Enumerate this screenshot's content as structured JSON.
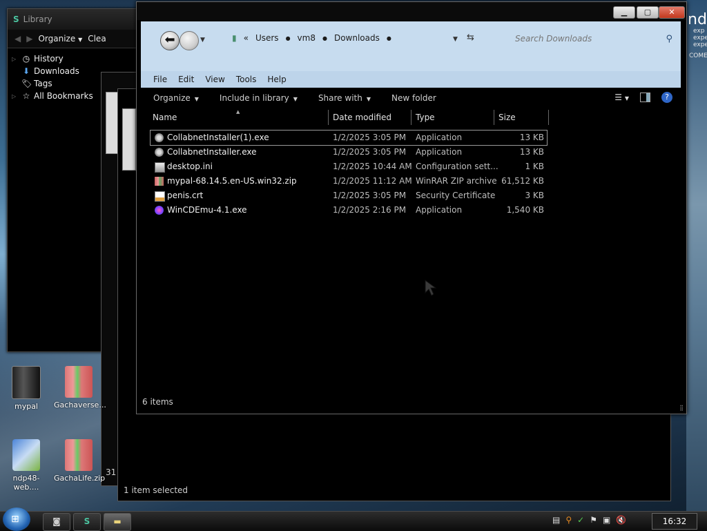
{
  "desktop": {
    "brand_text": "ndo",
    "brand_lines": [
      "exp",
      "expe",
      "expe",
      "COME"
    ],
    "icons": [
      {
        "label": "mypal"
      },
      {
        "label": "Gachaverse..."
      },
      {
        "label": "ndp48-web...."
      },
      {
        "label": "GachaLife.zip"
      }
    ]
  },
  "library": {
    "title": "Library",
    "toolbar": {
      "organize": "Organize",
      "clear": "Clea"
    },
    "tree": [
      {
        "label": "History",
        "icon": "clock-icon"
      },
      {
        "label": "Downloads",
        "icon": "download-arrow-icon"
      },
      {
        "label": "Tags",
        "icon": "tag-icon"
      },
      {
        "label": "All Bookmarks",
        "icon": "bookmark-icon"
      }
    ]
  },
  "background_windows": {
    "footer_status": "1 item selected",
    "number": "31"
  },
  "explorer": {
    "breadcrumbs": [
      "Users",
      "vm8",
      "Downloads"
    ],
    "search_placeholder": "Search Downloads",
    "menu": [
      "File",
      "Edit",
      "View",
      "Tools",
      "Help"
    ],
    "commands": {
      "organize": "Organize",
      "include": "Include in library",
      "share": "Share with",
      "new_folder": "New folder"
    },
    "columns": {
      "name": "Name",
      "date": "Date modified",
      "type": "Type",
      "size": "Size"
    },
    "files": [
      {
        "name": "CollabnetInstaller(1).exe",
        "date": "1/2/2025 3:05 PM",
        "type": "Application",
        "size": "13 KB",
        "icon": "exe-installer-icon",
        "selected": true
      },
      {
        "name": "CollabnetInstaller.exe",
        "date": "1/2/2025 3:05 PM",
        "type": "Application",
        "size": "13 KB",
        "icon": "exe-installer-icon",
        "selected": false
      },
      {
        "name": "desktop.ini",
        "date": "1/2/2025 10:44 AM",
        "type": "Configuration sett...",
        "size": "1 KB",
        "icon": "config-file-icon",
        "selected": false
      },
      {
        "name": "mypal-68.14.5.en-US.win32.zip",
        "date": "1/2/2025 11:12 AM",
        "type": "WinRAR ZIP archive",
        "size": "61,512 KB",
        "icon": "winrar-archive-icon",
        "selected": false
      },
      {
        "name": "penis.crt",
        "date": "1/2/2025 3:05 PM",
        "type": "Security Certificate",
        "size": "3 KB",
        "icon": "certificate-icon",
        "selected": false
      },
      {
        "name": "WinCDEmu-4.1.exe",
        "date": "1/2/2025 2:16 PM",
        "type": "Application",
        "size": "1,540 KB",
        "icon": "wincdemu-app-icon",
        "selected": false
      }
    ],
    "status": "6 items"
  },
  "taskbar": {
    "clock": "16:32"
  }
}
